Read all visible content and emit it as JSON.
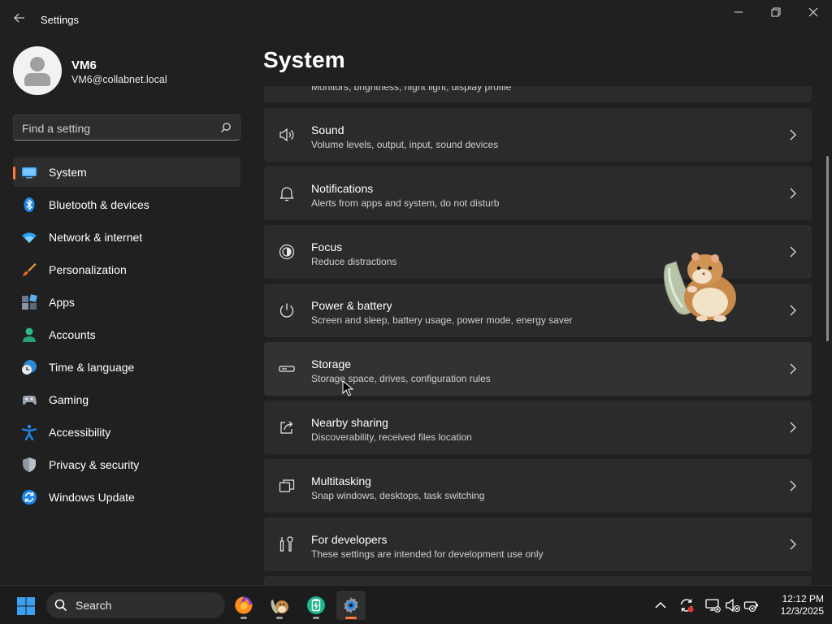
{
  "window": {
    "title": "Settings",
    "back_icon": "back-arrow-icon",
    "minimize_icon": "minimize-icon",
    "maximize_icon": "restore-icon",
    "close_icon": "close-icon"
  },
  "profile": {
    "name": "VM6",
    "email": "VM6@collabnet.local"
  },
  "search": {
    "placeholder": "Find a setting"
  },
  "nav": {
    "items": [
      {
        "label": "System",
        "icon": "system-icon",
        "active": true
      },
      {
        "label": "Bluetooth & devices",
        "icon": "bluetooth-icon"
      },
      {
        "label": "Network & internet",
        "icon": "wifi-icon"
      },
      {
        "label": "Personalization",
        "icon": "brush-icon"
      },
      {
        "label": "Apps",
        "icon": "apps-icon"
      },
      {
        "label": "Accounts",
        "icon": "account-icon"
      },
      {
        "label": "Time & language",
        "icon": "time-language-icon"
      },
      {
        "label": "Gaming",
        "icon": "gamepad-icon"
      },
      {
        "label": "Accessibility",
        "icon": "accessibility-icon"
      },
      {
        "label": "Privacy & security",
        "icon": "shield-icon"
      },
      {
        "label": "Windows Update",
        "icon": "update-icon"
      }
    ]
  },
  "main": {
    "title": "System",
    "partial_card_subtitle": "Monitors, brightness, night light, display profile",
    "cards": [
      {
        "title": "Sound",
        "subtitle": "Volume levels, output, input, sound devices",
        "icon": "speaker-icon"
      },
      {
        "title": "Notifications",
        "subtitle": "Alerts from apps and system, do not disturb",
        "icon": "bell-icon"
      },
      {
        "title": "Focus",
        "subtitle": "Reduce distractions",
        "icon": "focus-icon"
      },
      {
        "title": "Power & battery",
        "subtitle": "Screen and sleep, battery usage, power mode, energy saver",
        "icon": "power-icon"
      },
      {
        "title": "Storage",
        "subtitle": "Storage space, drives, configuration rules",
        "icon": "storage-icon"
      },
      {
        "title": "Nearby sharing",
        "subtitle": "Discoverability, received files location",
        "icon": "share-icon"
      },
      {
        "title": "Multitasking",
        "subtitle": "Snap windows, desktops, task switching",
        "icon": "multitasking-icon"
      },
      {
        "title": "For developers",
        "subtitle": "These settings are intended for development use only",
        "icon": "developer-tools-icon"
      }
    ]
  },
  "taskbar": {
    "search_label": "Search",
    "time": "12:12 PM",
    "date": "12/3/2025",
    "apps": [
      "firefox-icon",
      "hamster-app-icon",
      "clipboard-app-icon",
      "settings-gear-icon"
    ],
    "tray": [
      "chevron-up-icon",
      "sync-icon",
      "network-disconnected-icon",
      "volume-muted-icon",
      "battery-icon"
    ]
  },
  "colors": {
    "accent": "#ff7a3d",
    "background": "#202020",
    "card": "#2b2b2b",
    "taskbar": "#1c1c1c"
  }
}
